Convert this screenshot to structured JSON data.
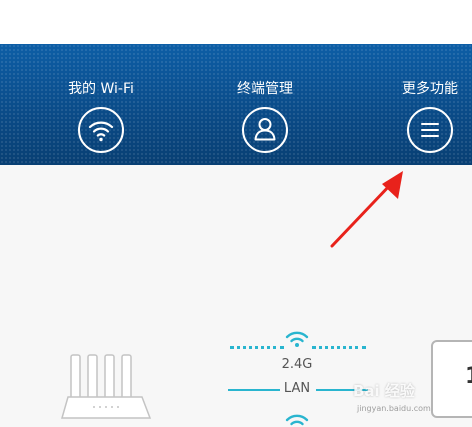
{
  "nav": {
    "items": [
      {
        "label": "我的 Wi-Fi",
        "icon": "wifi-icon"
      },
      {
        "label": "终端管理",
        "icon": "user-icon"
      },
      {
        "label": "更多功能",
        "icon": "menu-icon"
      }
    ]
  },
  "topology": {
    "band_label": "2.4G",
    "lan_label": "LAN"
  },
  "watermark": {
    "text": "Bai 经验",
    "sub": "jingyan.baidu.com"
  },
  "colors": {
    "nav_bg": "#0a4f8f",
    "line": "#29b5cf",
    "arrow": "#e8221b"
  }
}
